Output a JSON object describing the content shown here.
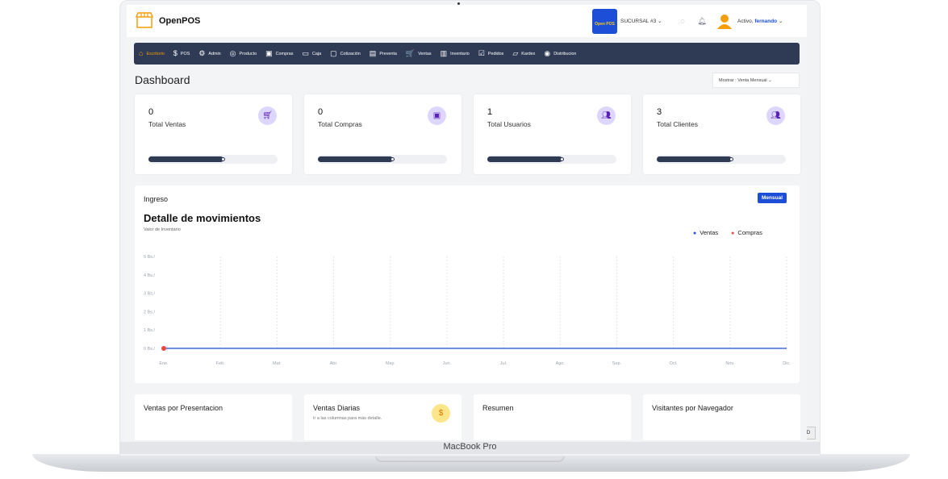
{
  "app": {
    "name": "OpenPOS"
  },
  "header": {
    "store_logo_text": "Open POS",
    "branch": "SUCURSAL #3",
    "status_prefix": "Activo,",
    "username": "fernando"
  },
  "nav": {
    "items": [
      {
        "label": "Escritorio",
        "icon": "⌂",
        "active": true
      },
      {
        "label": "POS",
        "icon": "$"
      },
      {
        "label": "Admin",
        "icon": "⚙"
      },
      {
        "label": "Producto",
        "icon": "◎"
      },
      {
        "label": "Compras",
        "icon": "▣"
      },
      {
        "label": "Caja",
        "icon": "▭"
      },
      {
        "label": "Cotización",
        "icon": "▢"
      },
      {
        "label": "Preventa",
        "icon": "▤"
      },
      {
        "label": "Ventas",
        "icon": "🛒"
      },
      {
        "label": "Inventario",
        "icon": "▥"
      },
      {
        "label": "Pedidos",
        "icon": "☑"
      },
      {
        "label": "Kardex",
        "icon": "▱"
      },
      {
        "label": "Distribucion",
        "icon": "◉"
      }
    ]
  },
  "page": {
    "title": "Dashboard",
    "show_select": "Mostrar : Venta Mensual"
  },
  "stats": [
    {
      "value": "0",
      "label": "Total Ventas",
      "icon": "cart-icon",
      "progress": 0.58
    },
    {
      "value": "0",
      "label": "Total Compras",
      "icon": "bag-icon",
      "progress": 0.58
    },
    {
      "value": "1",
      "label": "Total Usuarios",
      "icon": "users-icon",
      "progress": 0.58
    },
    {
      "value": "3",
      "label": "Total Clientes",
      "icon": "users-icon",
      "progress": 0.58
    }
  ],
  "chart_card": {
    "section": "Ingreso",
    "period_button": "Mensual",
    "title": "Detalle de movimientos",
    "subtitle": "Valor de Inventario"
  },
  "chart_data": {
    "type": "line",
    "categories": [
      "Ene.",
      "Feb.",
      "Mar.",
      "Abr.",
      "May.",
      "Jun.",
      "Jul.",
      "Ago.",
      "Sep.",
      "Oct.",
      "Nov.",
      "Dic."
    ],
    "y_ticks": [
      "0 Bs./",
      "1 Bs./",
      "2 Bs./",
      "3 Bs./",
      "4 Bs./",
      "5 Bs./"
    ],
    "ylim": [
      0,
      5
    ],
    "series": [
      {
        "name": "Ventas",
        "color": "#1d4ed8",
        "values": [
          0,
          0,
          0,
          0,
          0,
          0,
          0,
          0,
          0,
          0,
          0,
          0
        ]
      },
      {
        "name": "Compras",
        "color": "#ef4444",
        "values": [
          0,
          null,
          null,
          null,
          null,
          null,
          null,
          null,
          null,
          null,
          null,
          null
        ]
      }
    ],
    "legend": "top-right",
    "grid": "vertical"
  },
  "bottom_cards": [
    {
      "title": "Ventas por Presentacion",
      "subtitle": ""
    },
    {
      "title": "Ventas Diarias",
      "subtitle": "Ir a las columnas para más detalle."
    },
    {
      "title": "Resumen",
      "subtitle": ""
    },
    {
      "title": "Visitantes por Navegador",
      "subtitle": ""
    }
  ],
  "device": {
    "label": "MacBook Pro"
  },
  "side_tab": "D"
}
